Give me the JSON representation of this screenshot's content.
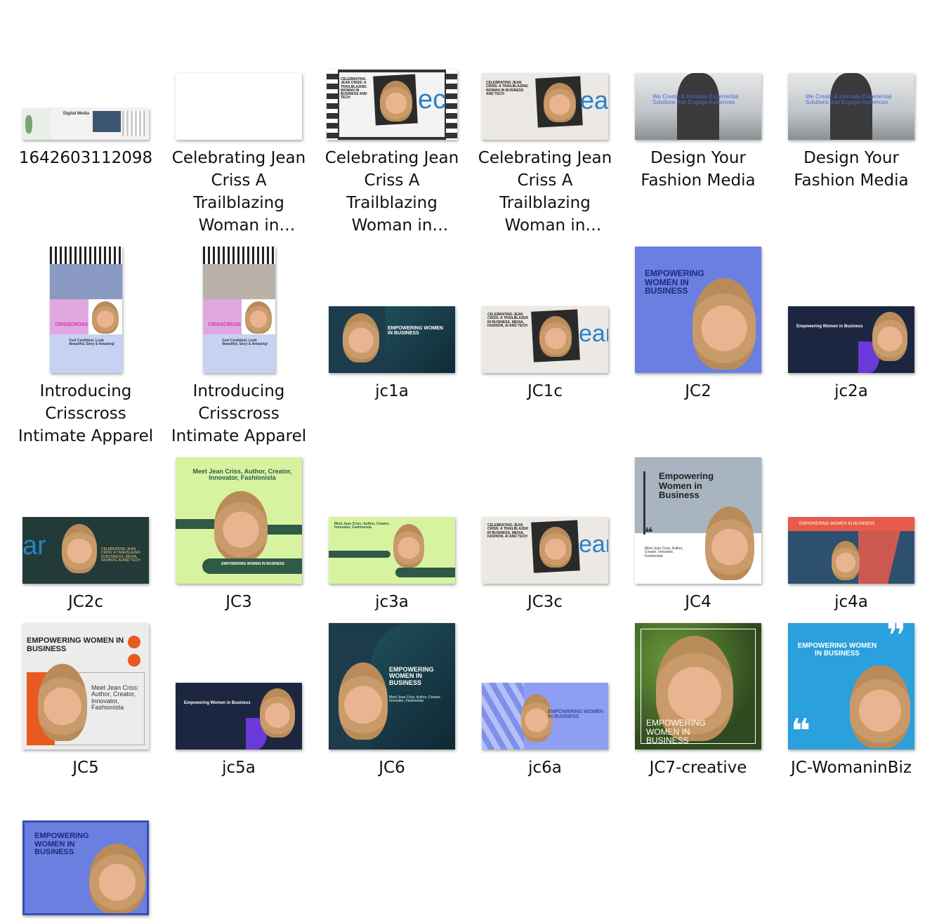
{
  "files": [
    {
      "id": "f1",
      "label": "1642603112098"
    },
    {
      "id": "f2",
      "label": "Celebrating Jean Criss A Trailblazing Woman in Business"
    },
    {
      "id": "f3",
      "label": "Celebrating Jean Criss A Trailblazing Woman in Business"
    },
    {
      "id": "f4",
      "label": "Celebrating Jean Criss A Trailblazing Woman in Business"
    },
    {
      "id": "f5",
      "label": "Design Your Fashion Media"
    },
    {
      "id": "f6",
      "label": "Design Your Fashion Media"
    },
    {
      "id": "f7",
      "label": "Introducing Crisscross Intimate Apparel"
    },
    {
      "id": "f8",
      "label": "Introducing Crisscross Intimate Apparel"
    },
    {
      "id": "f9",
      "label": "jc1a"
    },
    {
      "id": "f10",
      "label": "JC1c"
    },
    {
      "id": "f11",
      "label": "JC2"
    },
    {
      "id": "f12",
      "label": "jc2a"
    },
    {
      "id": "f13",
      "label": "JC2c"
    },
    {
      "id": "f14",
      "label": "JC3"
    },
    {
      "id": "f15",
      "label": "jc3a"
    },
    {
      "id": "f16",
      "label": "JC3c"
    },
    {
      "id": "f17",
      "label": "JC4"
    },
    {
      "id": "f18",
      "label": "jc4a"
    },
    {
      "id": "f19",
      "label": "JC5"
    },
    {
      "id": "f20",
      "label": "jc5a"
    },
    {
      "id": "f21",
      "label": "JC6"
    },
    {
      "id": "f22",
      "label": "jc6a"
    },
    {
      "id": "f23",
      "label": "JC7-creative"
    },
    {
      "id": "f24",
      "label": "JC-WomaninBiz"
    },
    {
      "id": "f25",
      "label": ""
    }
  ],
  "thumb_text": {
    "empowering": "EMPOWERING WOMEN IN BUSINESS",
    "empowering_mixed": "Empowering Women in Business",
    "meet": "Meet Jean Criss, Author, Creator, Innovator, Fashionista",
    "meet_short": "Meet Jean Criss: Author, Creator, Innovator, Fashionista",
    "celebrating": "CELEBRATING JEAN CRISS: A TRAILBLAZING WOMAN IN BUSINESS AND TECH",
    "trailblazer": "CELEBRATING JEAN CRISS: A TRAILBLAZER IN BUSINESS, MEDIA, FASHION, AI AND TECH",
    "design": "We Create & Innovate Experiential Solutions that Engage Audiences",
    "crisscross": "CRISSCROSS",
    "crisscross_tag": "Feel Confident, Look Beautiful, Sexy & Amazing!",
    "digital_media": "Digital Media"
  },
  "colors": {
    "blue": "#6a7fe0",
    "navy": "#1c2640",
    "teal_dark": "#1f4e5a",
    "lime": "#d8f3a0",
    "green_dark": "#2e5a46",
    "orange": "#e85a20",
    "sky": "#2aa0dc",
    "lavender": "#8e9ef2"
  }
}
